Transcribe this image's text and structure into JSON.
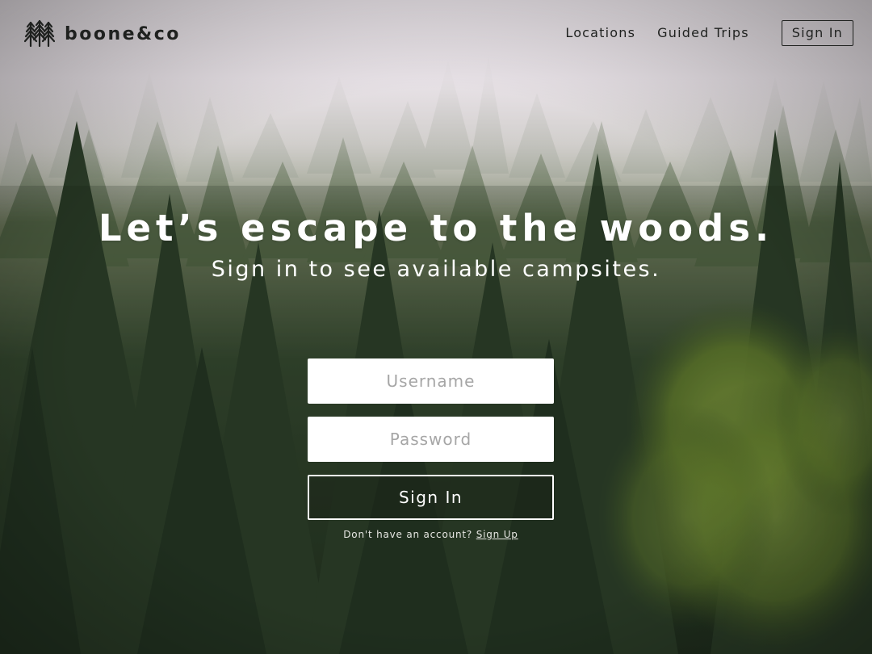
{
  "brand": {
    "name": "boone&co",
    "icon": "pine-trees-icon"
  },
  "nav": {
    "items": [
      {
        "label": "Locations"
      },
      {
        "label": "Guided Trips"
      }
    ],
    "signin_label": "Sign In"
  },
  "hero": {
    "title": "Let’s escape to the woods.",
    "subtitle": "Sign in to see available campsites."
  },
  "form": {
    "username": {
      "value": "",
      "placeholder": "Username"
    },
    "password": {
      "value": "",
      "placeholder": "Password"
    },
    "submit_label": "Sign In",
    "signup_prompt": "Don't have an account?",
    "signup_link": "Sign Up"
  },
  "colors": {
    "header_text": "#1f211f",
    "hero_text": "#ffffff",
    "input_bg": "#ffffff",
    "placeholder": "#a6a6a6",
    "fog": "#e9e4ea",
    "forest_dark": "#1e2b1c",
    "foliage_highlight": "#7e9a3a"
  }
}
